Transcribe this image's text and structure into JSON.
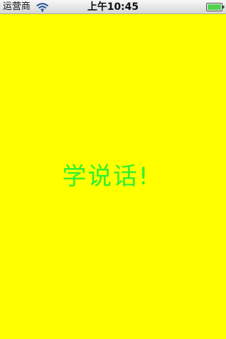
{
  "status_bar": {
    "carrier": "运营商",
    "time": "上午10:45",
    "wifi_icon": "wifi-icon",
    "battery_icon": "battery-icon"
  },
  "main": {
    "message": "学说话!",
    "background_color": "#ffff00",
    "message_color": "#2ff02f"
  }
}
